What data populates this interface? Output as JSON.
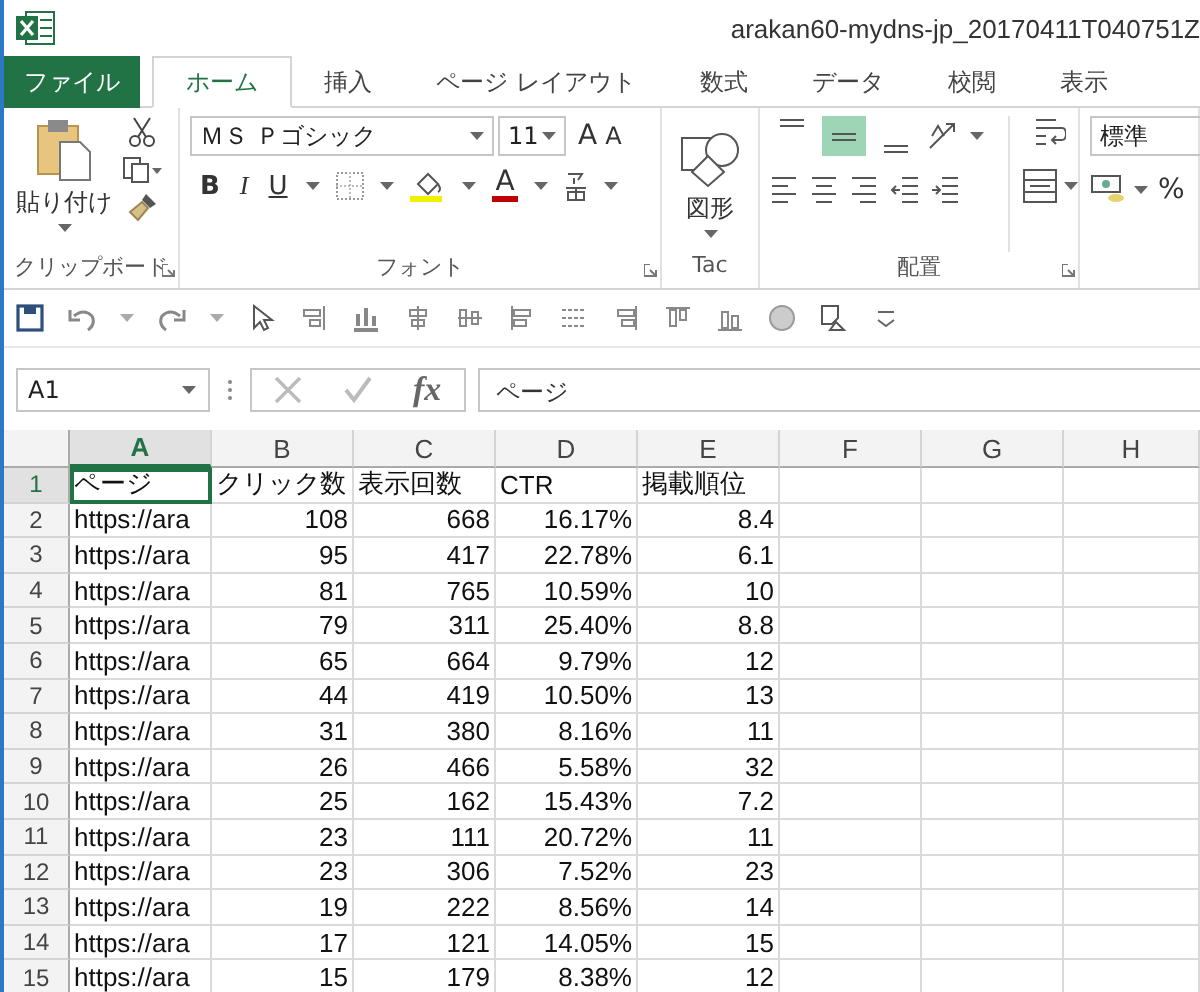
{
  "title_bar": {
    "title": "arakan60-mydns-jp_20170411T040751Z"
  },
  "tabs": [
    {
      "label": "ファイル",
      "kind": "file",
      "selected": false
    },
    {
      "label": "ホーム",
      "kind": "tab",
      "selected": true
    },
    {
      "label": "挿入",
      "kind": "tab",
      "selected": false
    },
    {
      "label": "ページ レイアウト",
      "kind": "tab",
      "selected": false
    },
    {
      "label": "数式",
      "kind": "tab",
      "selected": false
    },
    {
      "label": "データ",
      "kind": "tab",
      "selected": false
    },
    {
      "label": "校閲",
      "kind": "tab",
      "selected": false
    },
    {
      "label": "表示",
      "kind": "tab",
      "selected": false
    }
  ],
  "ribbon": {
    "clipboard": {
      "paste_label": "貼り付け",
      "group_label": "クリップボード"
    },
    "font": {
      "font_name": "ＭＳ Ｐゴシック",
      "font_size": "11",
      "grow": "A",
      "shrink": "A",
      "bold": "B",
      "italic": "I",
      "underline": "U",
      "font_color": "A",
      "group_label": "フォント"
    },
    "shapes": {
      "label": "図形",
      "group_label": "Tac"
    },
    "alignment": {
      "vertical": [
        {
          "selected": false
        },
        {
          "selected": true
        },
        {
          "selected": false
        }
      ],
      "group_label": "配置"
    },
    "number": {
      "format": "標準",
      "percent": "%"
    }
  },
  "formula_bar": {
    "name_box": "A1",
    "fx": "fx",
    "value": "ページ"
  },
  "grid": {
    "columns": [
      {
        "label": "A",
        "selected": true,
        "kind": "text"
      },
      {
        "label": "B",
        "selected": false,
        "kind": "number"
      },
      {
        "label": "C",
        "selected": false,
        "kind": "number"
      },
      {
        "label": "D",
        "selected": false,
        "kind": "number"
      },
      {
        "label": "E",
        "selected": false,
        "kind": "number"
      },
      {
        "label": "F",
        "selected": false
      },
      {
        "label": "G",
        "selected": false
      },
      {
        "label": "H",
        "selected": false
      }
    ],
    "header_row": {
      "number": "1",
      "cells": [
        "ページ",
        "クリック数",
        "表示回数",
        "CTR",
        "掲載順位"
      ]
    },
    "rows": [
      {
        "number": "2",
        "cells": [
          "https://ara",
          "108",
          "668",
          "16.17%",
          "8.4"
        ]
      },
      {
        "number": "3",
        "cells": [
          "https://ara",
          "95",
          "417",
          "22.78%",
          "6.1"
        ]
      },
      {
        "number": "4",
        "cells": [
          "https://ara",
          "81",
          "765",
          "10.59%",
          "10"
        ]
      },
      {
        "number": "5",
        "cells": [
          "https://ara",
          "79",
          "311",
          "25.40%",
          "8.8"
        ]
      },
      {
        "number": "6",
        "cells": [
          "https://ara",
          "65",
          "664",
          "9.79%",
          "12"
        ]
      },
      {
        "number": "7",
        "cells": [
          "https://ara",
          "44",
          "419",
          "10.50%",
          "13"
        ]
      },
      {
        "number": "8",
        "cells": [
          "https://ara",
          "31",
          "380",
          "8.16%",
          "11"
        ]
      },
      {
        "number": "9",
        "cells": [
          "https://ara",
          "26",
          "466",
          "5.58%",
          "32"
        ]
      },
      {
        "number": "10",
        "cells": [
          "https://ara",
          "25",
          "162",
          "15.43%",
          "7.2"
        ]
      },
      {
        "number": "11",
        "cells": [
          "https://ara",
          "23",
          "111",
          "20.72%",
          "11"
        ]
      },
      {
        "number": "12",
        "cells": [
          "https://ara",
          "23",
          "306",
          "7.52%",
          "23"
        ]
      },
      {
        "number": "13",
        "cells": [
          "https://ara",
          "19",
          "222",
          "8.56%",
          "14"
        ]
      },
      {
        "number": "14",
        "cells": [
          "https://ara",
          "17",
          "121",
          "14.05%",
          "15"
        ]
      },
      {
        "number": "15",
        "cells": [
          "https://ara",
          "15",
          "179",
          "8.38%",
          "12"
        ]
      }
    ]
  }
}
